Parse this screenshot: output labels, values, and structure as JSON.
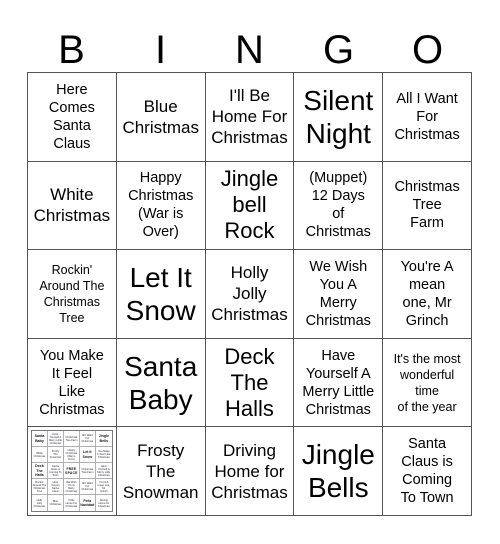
{
  "header": {
    "letters": [
      "B",
      "I",
      "N",
      "G",
      "O"
    ]
  },
  "colors": {
    "background": "#ffffff",
    "text": "#000000",
    "grid_border": "#555555",
    "mini_border": "#b0b0b0"
  },
  "grid": {
    "columns": 5,
    "rows": 5,
    "cells": [
      {
        "text": "Here\nComes\nSanta\nClaus",
        "size": "s",
        "type": "text"
      },
      {
        "text": "Blue\nChristmas",
        "size": "m",
        "type": "text"
      },
      {
        "text": "I'll Be\nHome For\nChristmas",
        "size": "m",
        "type": "text"
      },
      {
        "text": "Silent\nNight",
        "size": "xl",
        "type": "text"
      },
      {
        "text": "All I Want\nFor\nChristmas",
        "size": "s",
        "type": "text"
      },
      {
        "text": "White\nChristmas",
        "size": "m",
        "type": "text"
      },
      {
        "text": "Happy\nChristmas\n(War is\nOver)",
        "size": "s",
        "type": "text"
      },
      {
        "text": "Jingle\nbell\nRock",
        "size": "l",
        "type": "text"
      },
      {
        "text": "(Muppet)\n12 Days\nof\nChristmas",
        "size": "s",
        "type": "text"
      },
      {
        "text": "Christmas\nTree\nFarm",
        "size": "s",
        "type": "text"
      },
      {
        "text": "Rockin'\nAround The\nChristmas\nTree",
        "size": "xs",
        "type": "text"
      },
      {
        "text": "Let It\nSnow",
        "size": "xl",
        "type": "text"
      },
      {
        "text": "Holly\nJolly\nChristmas",
        "size": "m",
        "type": "text"
      },
      {
        "text": "We Wish\nYou A\nMerry\nChristmas",
        "size": "s",
        "type": "text"
      },
      {
        "text": "You're A\nmean\none, Mr\nGrinch",
        "size": "s",
        "type": "text"
      },
      {
        "text": "You Make\nIt Feel\nLike\nChristmas",
        "size": "s",
        "type": "text"
      },
      {
        "text": "Santa\nBaby",
        "size": "xl",
        "type": "text"
      },
      {
        "text": "Deck\nThe\nHalls",
        "size": "l",
        "type": "text"
      },
      {
        "text": "Have\nYourself A\nMerry Little\nChristmas",
        "size": "s",
        "type": "text"
      },
      {
        "text": "It's the most\nwonderful\ntime\nof the year",
        "size": "xs",
        "type": "text"
      },
      {
        "text": "",
        "size": "xs",
        "type": "mini-card"
      },
      {
        "text": "Frosty\nThe\nSnowman",
        "size": "m",
        "type": "text"
      },
      {
        "text": "Driving\nHome for\nChristmas",
        "size": "m",
        "type": "text"
      },
      {
        "text": "Jingle\nBells",
        "size": "xl",
        "type": "text"
      },
      {
        "text": "Santa\nClaus is\nComing\nTo Town",
        "size": "s",
        "type": "text"
      }
    ]
  },
  "mini_card": {
    "columns": 5,
    "rows": 5,
    "cells": [
      {
        "text": "Santa\nBaby",
        "emphasis": "bold"
      },
      {
        "text": "Have\nYourself A\nMerry Little\nChristmas",
        "emphasis": "none"
      },
      {
        "text": "Christmas\nTree Farm",
        "emphasis": "none"
      },
      {
        "text": "All I Want\nFor\nChristmas",
        "emphasis": "none"
      },
      {
        "text": "Jingle\nBells",
        "emphasis": "bold"
      },
      {
        "text": "White\nChristmas",
        "emphasis": "none"
      },
      {
        "text": "Frosty\nThe\nSnowman",
        "emphasis": "none"
      },
      {
        "text": "Happy\nChristmas\n(War is\nOver)",
        "emphasis": "none"
      },
      {
        "text": "Let It\nSnow",
        "emphasis": "bold"
      },
      {
        "text": "You Make\nIt Feel Like\nChristmas",
        "emphasis": "none"
      },
      {
        "text": "Deck\nThe\nHalls",
        "emphasis": "bold"
      },
      {
        "text": "Santa\nClaus is\nComing To\nTown",
        "emphasis": "none"
      },
      {
        "text": "FREE\nSPACE",
        "emphasis": "free"
      },
      {
        "text": "Christmas\nTree Farm",
        "emphasis": "none"
      },
      {
        "text": "Have\nYourself A\nMerry Little\nChristmas",
        "emphasis": "none"
      },
      {
        "text": "Rockin'\nAround The\nChristmas\nTree",
        "emphasis": "none"
      },
      {
        "text": "Here\nComes\nSanta\nClaus",
        "emphasis": "none"
      },
      {
        "text": "We Wish\nYou A\nMerry\nChristmas",
        "emphasis": "none"
      },
      {
        "text": "All I Want\nFor\nChristmas",
        "emphasis": "none"
      },
      {
        "text": "You're A\nmean one,\nMr\nGrinch",
        "emphasis": "none"
      },
      {
        "text": "Holly\nJolly\nChristmas",
        "emphasis": "none"
      },
      {
        "text": "Blue\nChristmas",
        "emphasis": "none"
      },
      {
        "text": "I'll Be\nHome For\nChristmas",
        "emphasis": "none"
      },
      {
        "text": "Feliz\nNavidad",
        "emphasis": "bold"
      },
      {
        "text": "Driving\nHome for\nChristmas",
        "emphasis": "none"
      }
    ]
  }
}
